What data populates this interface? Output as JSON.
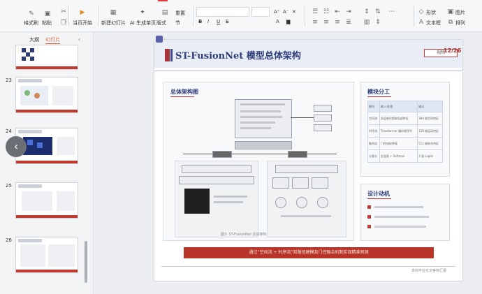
{
  "ribbon": {
    "format_painter": "格式刷",
    "paste": "粘贴",
    "start_show": "当页开始",
    "new_slide": "新建幻灯片",
    "ai_slide": "AI 生成单页",
    "layout": "版式",
    "reset": "重置",
    "section": "节",
    "shape": "形状",
    "textbox": "文本框",
    "picture": "图片",
    "arrange": "排列"
  },
  "left_panel": {
    "tab_outline": "大纲",
    "tab_slides": "幻灯片",
    "slide_numbers": [
      "23",
      "24",
      "25",
      "26"
    ]
  },
  "slide": {
    "title": "ST-FusionNet 模型总体架构",
    "page": "12/26",
    "button_label": "视频",
    "panel_left_title": "总体架构图",
    "panel_right_title": "模块分工",
    "panel_right2_title": "设计动机",
    "caption": "图3: ST-FusionNet 总体架构",
    "red_banner": "通过“空间流 + 时序流”双路径建模及门控融合机制实现精准预测",
    "footer": "本科毕业论文答辩汇报",
    "table_rows": [
      [
        "模块",
        "输入/处理",
        "输出"
      ],
      [
        "空间流",
        "多层卷积提取局部特征",
        "384 维空间特征"
      ],
      [
        "时序流",
        "Transformer 编码帧序列",
        "128 维运动特征"
      ],
      [
        "融合层",
        "门控加权拼接",
        "512 维联合特征"
      ],
      [
        "分类头",
        "全连接 + Softmax",
        "3 类 Logits"
      ]
    ]
  }
}
